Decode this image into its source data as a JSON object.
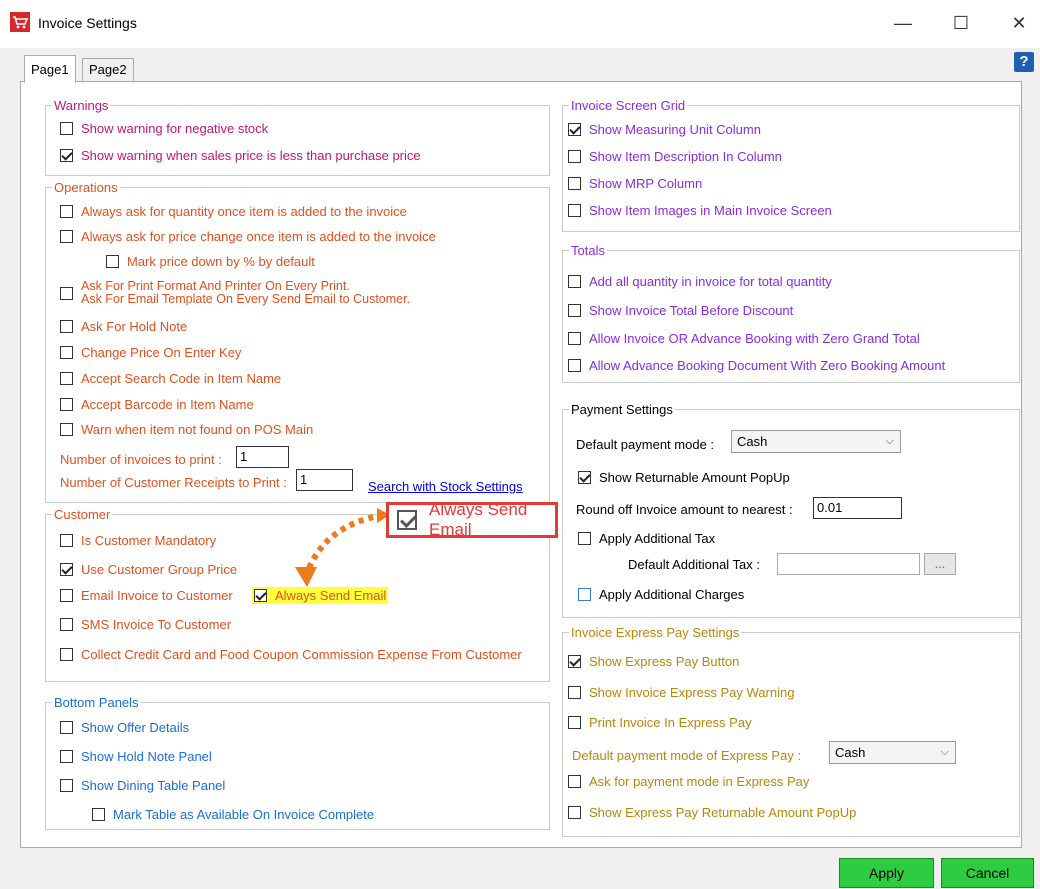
{
  "window": {
    "title": "Invoice Settings",
    "minimize": "—",
    "maximize": "☐",
    "close": "✕",
    "help": "?"
  },
  "tabs": [
    {
      "label": "Page1"
    },
    {
      "label": "Page2"
    }
  ],
  "warnings": {
    "legend": "Warnings",
    "items": [
      {
        "label": "Show warning for negative stock",
        "checked": false
      },
      {
        "label": "Show warning when sales price is less than purchase price",
        "checked": true
      }
    ]
  },
  "operations": {
    "legend": "Operations",
    "items": [
      "Always ask for quantity once item is added to the invoice",
      "Always ask for price change once item is added to the invoice",
      "Mark price down by % by default",
      "Ask For Print Format And  Printer On Every Print.",
      "Ask For Email Template On Every Send Email to Customer.",
      "Ask For Hold Note",
      "Change Price On Enter Key",
      "Accept Search Code in Item Name",
      "Accept Barcode in Item Name",
      "Warn when item not found on POS Main"
    ],
    "num_invoices_label": "Number of invoices to print :",
    "num_invoices_value": "1",
    "num_receipts_label": "Number of Customer Receipts to Print :",
    "num_receipts_value": "1",
    "search_link": "Search with Stock Settings"
  },
  "customer": {
    "legend": "Customer",
    "items": [
      {
        "label": "Is Customer Mandatory",
        "checked": false
      },
      {
        "label": "Use Customer Group Price",
        "checked": true
      },
      {
        "label": "Email Invoice to Customer",
        "checked": false
      },
      {
        "label": "SMS Invoice To Customer",
        "checked": false
      },
      {
        "label": "Collect Credit Card and Food Coupon Commission Expense From Customer",
        "checked": false
      }
    ],
    "always_send_email": "Always Send Email",
    "callout_label": "Always Send Email"
  },
  "bottom_panels": {
    "legend": "Bottom Panels",
    "items": [
      "Show Offer Details",
      "Show Hold Note Panel",
      "Show Dining Table Panel",
      "Mark Table as Available On Invoice Complete"
    ]
  },
  "invoice_grid": {
    "legend": "Invoice Screen Grid",
    "items": [
      {
        "label": "Show Measuring Unit Column",
        "checked": true
      },
      {
        "label": "Show Item Description In Column",
        "checked": false
      },
      {
        "label": "Show MRP Column",
        "checked": false
      },
      {
        "label": "Show Item Images in Main Invoice Screen",
        "checked": false
      }
    ]
  },
  "totals": {
    "legend": "Totals",
    "items": [
      "Add all quantity in invoice for total quantity",
      "Show Invoice Total Before Discount",
      "Allow Invoice OR Advance Booking with Zero Grand Total",
      "Allow Advance Booking Document With Zero Booking Amount"
    ]
  },
  "payment": {
    "legend": "Payment Settings",
    "default_mode_label": "Default payment mode :",
    "default_mode_value": "Cash",
    "show_returnable": "Show Returnable Amount PopUp",
    "round_off_label": "Round off Invoice amount to nearest :",
    "round_off_value": "0.01",
    "apply_additional_tax": "Apply Additional Tax",
    "default_additional_tax_label": "Default Additional Tax :",
    "default_additional_tax_value": "",
    "browse_label": "...",
    "apply_additional_charges": "Apply Additional Charges"
  },
  "express_pay": {
    "legend": "Invoice Express Pay Settings",
    "items": [
      {
        "label": "Show Express Pay Button",
        "checked": true
      },
      {
        "label": "Show Invoice Express Pay Warning",
        "checked": false
      },
      {
        "label": "Print Invoice In Express Pay",
        "checked": false
      }
    ],
    "default_mode_label": "Default payment mode of Express Pay :",
    "default_mode_value": "Cash",
    "items2": [
      "Ask for payment mode in Express Pay",
      "Show Express Pay Returnable Amount PopUp"
    ]
  },
  "buttons": {
    "apply": "Apply",
    "cancel": "Cancel"
  }
}
